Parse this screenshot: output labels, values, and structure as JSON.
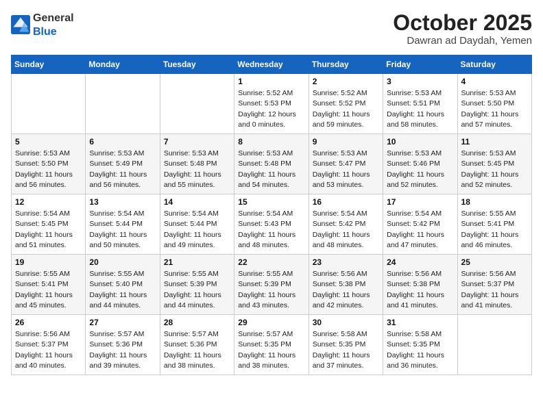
{
  "header": {
    "logo_general": "General",
    "logo_blue": "Blue",
    "month_title": "October 2025",
    "location": "Dawran ad Daydah, Yemen"
  },
  "weekdays": [
    "Sunday",
    "Monday",
    "Tuesday",
    "Wednesday",
    "Thursday",
    "Friday",
    "Saturday"
  ],
  "weeks": [
    [
      {
        "day": "",
        "sunrise": "",
        "sunset": "",
        "daylight": ""
      },
      {
        "day": "",
        "sunrise": "",
        "sunset": "",
        "daylight": ""
      },
      {
        "day": "",
        "sunrise": "",
        "sunset": "",
        "daylight": ""
      },
      {
        "day": "1",
        "sunrise": "Sunrise: 5:52 AM",
        "sunset": "Sunset: 5:53 PM",
        "daylight": "Daylight: 12 hours and 0 minutes."
      },
      {
        "day": "2",
        "sunrise": "Sunrise: 5:52 AM",
        "sunset": "Sunset: 5:52 PM",
        "daylight": "Daylight: 11 hours and 59 minutes."
      },
      {
        "day": "3",
        "sunrise": "Sunrise: 5:53 AM",
        "sunset": "Sunset: 5:51 PM",
        "daylight": "Daylight: 11 hours and 58 minutes."
      },
      {
        "day": "4",
        "sunrise": "Sunrise: 5:53 AM",
        "sunset": "Sunset: 5:50 PM",
        "daylight": "Daylight: 11 hours and 57 minutes."
      }
    ],
    [
      {
        "day": "5",
        "sunrise": "Sunrise: 5:53 AM",
        "sunset": "Sunset: 5:50 PM",
        "daylight": "Daylight: 11 hours and 56 minutes."
      },
      {
        "day": "6",
        "sunrise": "Sunrise: 5:53 AM",
        "sunset": "Sunset: 5:49 PM",
        "daylight": "Daylight: 11 hours and 56 minutes."
      },
      {
        "day": "7",
        "sunrise": "Sunrise: 5:53 AM",
        "sunset": "Sunset: 5:48 PM",
        "daylight": "Daylight: 11 hours and 55 minutes."
      },
      {
        "day": "8",
        "sunrise": "Sunrise: 5:53 AM",
        "sunset": "Sunset: 5:48 PM",
        "daylight": "Daylight: 11 hours and 54 minutes."
      },
      {
        "day": "9",
        "sunrise": "Sunrise: 5:53 AM",
        "sunset": "Sunset: 5:47 PM",
        "daylight": "Daylight: 11 hours and 53 minutes."
      },
      {
        "day": "10",
        "sunrise": "Sunrise: 5:53 AM",
        "sunset": "Sunset: 5:46 PM",
        "daylight": "Daylight: 11 hours and 52 minutes."
      },
      {
        "day": "11",
        "sunrise": "Sunrise: 5:53 AM",
        "sunset": "Sunset: 5:45 PM",
        "daylight": "Daylight: 11 hours and 52 minutes."
      }
    ],
    [
      {
        "day": "12",
        "sunrise": "Sunrise: 5:54 AM",
        "sunset": "Sunset: 5:45 PM",
        "daylight": "Daylight: 11 hours and 51 minutes."
      },
      {
        "day": "13",
        "sunrise": "Sunrise: 5:54 AM",
        "sunset": "Sunset: 5:44 PM",
        "daylight": "Daylight: 11 hours and 50 minutes."
      },
      {
        "day": "14",
        "sunrise": "Sunrise: 5:54 AM",
        "sunset": "Sunset: 5:44 PM",
        "daylight": "Daylight: 11 hours and 49 minutes."
      },
      {
        "day": "15",
        "sunrise": "Sunrise: 5:54 AM",
        "sunset": "Sunset: 5:43 PM",
        "daylight": "Daylight: 11 hours and 48 minutes."
      },
      {
        "day": "16",
        "sunrise": "Sunrise: 5:54 AM",
        "sunset": "Sunset: 5:42 PM",
        "daylight": "Daylight: 11 hours and 48 minutes."
      },
      {
        "day": "17",
        "sunrise": "Sunrise: 5:54 AM",
        "sunset": "Sunset: 5:42 PM",
        "daylight": "Daylight: 11 hours and 47 minutes."
      },
      {
        "day": "18",
        "sunrise": "Sunrise: 5:55 AM",
        "sunset": "Sunset: 5:41 PM",
        "daylight": "Daylight: 11 hours and 46 minutes."
      }
    ],
    [
      {
        "day": "19",
        "sunrise": "Sunrise: 5:55 AM",
        "sunset": "Sunset: 5:41 PM",
        "daylight": "Daylight: 11 hours and 45 minutes."
      },
      {
        "day": "20",
        "sunrise": "Sunrise: 5:55 AM",
        "sunset": "Sunset: 5:40 PM",
        "daylight": "Daylight: 11 hours and 44 minutes."
      },
      {
        "day": "21",
        "sunrise": "Sunrise: 5:55 AM",
        "sunset": "Sunset: 5:39 PM",
        "daylight": "Daylight: 11 hours and 44 minutes."
      },
      {
        "day": "22",
        "sunrise": "Sunrise: 5:55 AM",
        "sunset": "Sunset: 5:39 PM",
        "daylight": "Daylight: 11 hours and 43 minutes."
      },
      {
        "day": "23",
        "sunrise": "Sunrise: 5:56 AM",
        "sunset": "Sunset: 5:38 PM",
        "daylight": "Daylight: 11 hours and 42 minutes."
      },
      {
        "day": "24",
        "sunrise": "Sunrise: 5:56 AM",
        "sunset": "Sunset: 5:38 PM",
        "daylight": "Daylight: 11 hours and 41 minutes."
      },
      {
        "day": "25",
        "sunrise": "Sunrise: 5:56 AM",
        "sunset": "Sunset: 5:37 PM",
        "daylight": "Daylight: 11 hours and 41 minutes."
      }
    ],
    [
      {
        "day": "26",
        "sunrise": "Sunrise: 5:56 AM",
        "sunset": "Sunset: 5:37 PM",
        "daylight": "Daylight: 11 hours and 40 minutes."
      },
      {
        "day": "27",
        "sunrise": "Sunrise: 5:57 AM",
        "sunset": "Sunset: 5:36 PM",
        "daylight": "Daylight: 11 hours and 39 minutes."
      },
      {
        "day": "28",
        "sunrise": "Sunrise: 5:57 AM",
        "sunset": "Sunset: 5:36 PM",
        "daylight": "Daylight: 11 hours and 38 minutes."
      },
      {
        "day": "29",
        "sunrise": "Sunrise: 5:57 AM",
        "sunset": "Sunset: 5:35 PM",
        "daylight": "Daylight: 11 hours and 38 minutes."
      },
      {
        "day": "30",
        "sunrise": "Sunrise: 5:58 AM",
        "sunset": "Sunset: 5:35 PM",
        "daylight": "Daylight: 11 hours and 37 minutes."
      },
      {
        "day": "31",
        "sunrise": "Sunrise: 5:58 AM",
        "sunset": "Sunset: 5:35 PM",
        "daylight": "Daylight: 11 hours and 36 minutes."
      },
      {
        "day": "",
        "sunrise": "",
        "sunset": "",
        "daylight": ""
      }
    ]
  ]
}
